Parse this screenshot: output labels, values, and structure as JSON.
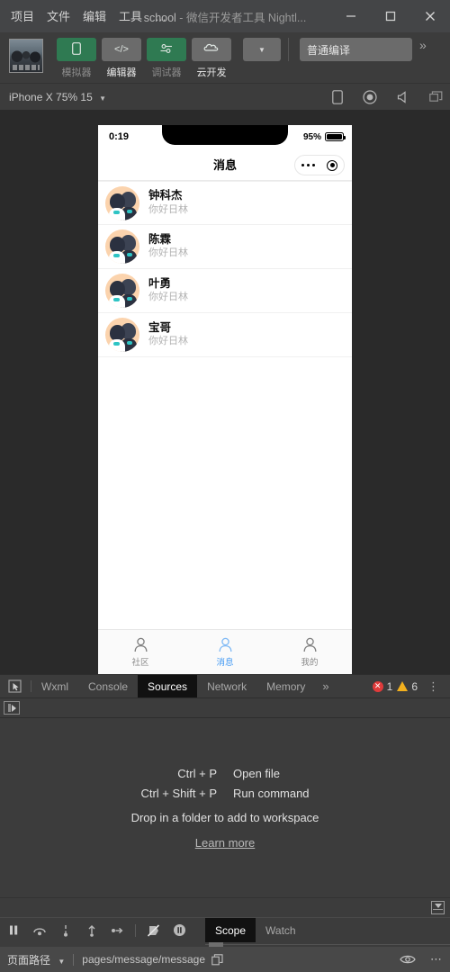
{
  "window": {
    "menus": [
      "项目",
      "文件",
      "编辑",
      "工具"
    ],
    "menu_overflow": "…",
    "title_project": "school",
    "title_dash": " - ",
    "title_app": "微信开发者工具 Nightl...",
    "buttons": {
      "minimize": "minimize-button",
      "maximize": "maximize-button",
      "close": "close-button"
    }
  },
  "toolbar": {
    "avatar_name": "user-avatar",
    "tools": [
      {
        "label": "模拟器",
        "icon": "phone-icon",
        "state": "green",
        "label_style": "dim"
      },
      {
        "label": "编辑器",
        "icon": "code-icon",
        "state": "grey",
        "label_style": "bright"
      },
      {
        "label": "调试器",
        "icon": "debug-icon",
        "state": "green",
        "label_style": "dim"
      },
      {
        "label": "云开发",
        "icon": "cloud-icon",
        "state": "grey",
        "label_style": "bright"
      }
    ],
    "mini_dropdown": "▼",
    "compile_mode": "普通编译",
    "overflow_chevron": "»"
  },
  "simulator_bar": {
    "device": "iPhone X 75% 15",
    "caret": "▼",
    "icons": [
      "rotate-device-icon",
      "record-icon",
      "volume-icon",
      "detach-window-icon"
    ]
  },
  "phone": {
    "status": {
      "time": "0:19",
      "battery_pct": "95%"
    },
    "navbar": {
      "title": "消息"
    },
    "capsule": {
      "menu": "capsule-menu-dots",
      "close": "capsule-target-icon"
    },
    "messages": [
      {
        "name": "钟科杰",
        "snippet": "你好日林"
      },
      {
        "name": "陈霖",
        "snippet": "你好日林"
      },
      {
        "name": "叶勇",
        "snippet": "你好日林"
      },
      {
        "name": "宝哥",
        "snippet": "你好日林"
      }
    ],
    "tabbar": [
      {
        "label": "社区",
        "icon": "person-icon",
        "active": false
      },
      {
        "label": "消息",
        "icon": "person-icon",
        "active": true
      },
      {
        "label": "我的",
        "icon": "person-icon",
        "active": false
      }
    ],
    "active_color": "#3e97f3"
  },
  "devtools": {
    "inspect_icon": "inspect-element-icon",
    "tabs": [
      {
        "label": "Wxml",
        "active": false
      },
      {
        "label": "Console",
        "active": false
      },
      {
        "label": "Sources",
        "active": true
      },
      {
        "label": "Network",
        "active": false
      },
      {
        "label": "Memory",
        "active": false
      }
    ],
    "more_chevron": "»",
    "error_count": "1",
    "warning_count": "6",
    "error_mark": "✕",
    "error_color": "#e03b3b",
    "warning_color": "#f2b01e",
    "kebab": "kebab-menu"
  },
  "sources": {
    "navigator_toggle": "show-navigator-button",
    "hints": [
      {
        "key": "Ctrl + P",
        "value": "Open file"
      },
      {
        "key": "Ctrl + Shift + P",
        "value": "Run command"
      }
    ],
    "drop_text": "Drop in a folder to add to workspace",
    "learn_more": "Learn more",
    "footer_toggle": "show-drawer-button"
  },
  "debugger": {
    "controls": [
      "pause-button",
      "step-over-button",
      "step-into-button",
      "step-out-button",
      "step-button",
      "deactivate-breakpoints-button",
      "pause-on-exceptions-button"
    ],
    "panes": [
      {
        "label": "Scope",
        "active": true
      },
      {
        "label": "Watch",
        "active": false
      }
    ]
  },
  "statusbar": {
    "label": "页面路径",
    "caret": "▼",
    "path": "pages/message/message",
    "copy_icon": "copy-icon",
    "eye_icon": "eye-icon",
    "more_icon": "more-options-icon"
  }
}
